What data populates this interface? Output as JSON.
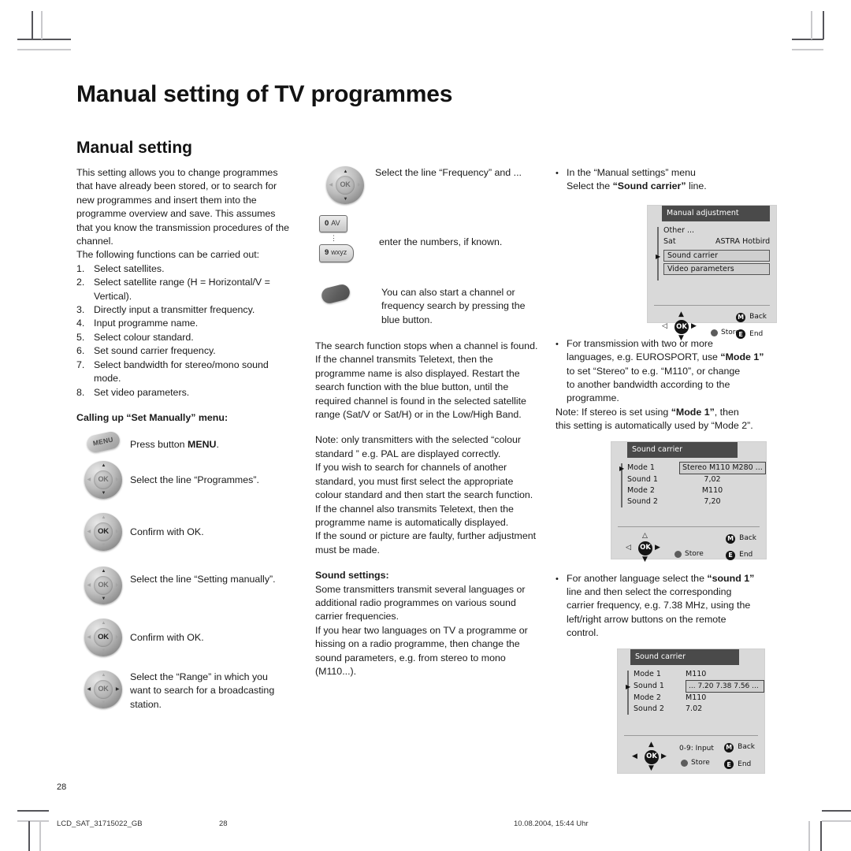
{
  "document": {
    "main_title": "Manual setting of TV programmes",
    "section_title": "Manual setting"
  },
  "left_column": {
    "intro": "This setting allows you to change programmes that have already been stored, or to search for new programmes and insert them into the programme overview and save. This assumes that you know the transmission procedures of the channel.",
    "functions_lead": "The following functions can be carried out:",
    "functions": [
      {
        "num": "1.",
        "text": "Select satellites."
      },
      {
        "num": "2.",
        "text": "Select satellite range (H = Horizontal/V = Vertical)."
      },
      {
        "num": "3.",
        "text": "Directly input a transmitter frequency."
      },
      {
        "num": "4.",
        "text": "Input programme name."
      },
      {
        "num": "5.",
        "text": "Select colour standard."
      },
      {
        "num": "6.",
        "text": "Set sound carrier frequency."
      },
      {
        "num": "7.",
        "text": "Select bandwidth for stereo/mono sound mode."
      },
      {
        "num": "8.",
        "text": "Set video parameters."
      }
    ],
    "calling_heading": "Calling up “Set Manually” menu:",
    "steps": [
      {
        "icon": "menu-key-icon",
        "key_label": "MENU",
        "text_before": "Press button ",
        "text_bold": "MENU",
        "text_after": "."
      },
      {
        "icon": "nav-pad-updown-icon",
        "ok_label": "OK",
        "text": "Select the line “Programmes”."
      },
      {
        "icon": "nav-pad-ok-icon",
        "ok_label": "OK",
        "text": "Confirm with OK."
      },
      {
        "icon": "nav-pad-updown-icon",
        "ok_label": "OK",
        "text": "Select the line “Setting manually”."
      },
      {
        "icon": "nav-pad-ok-icon",
        "ok_label": "OK",
        "text": "Confirm with OK."
      },
      {
        "icon": "nav-pad-leftright-icon",
        "ok_label": "OK",
        "text": "Select the “Range” in which you want to search for a broadcasting station."
      }
    ]
  },
  "middle_column": {
    "step_frequency": {
      "icon": "nav-pad-updown-icon",
      "ok_label": "OK",
      "text": "Select the line “Frequency” and ..."
    },
    "step_numbers": {
      "key_top_number": "0",
      "key_top_letters": "AV",
      "key_dots": "⋮",
      "key_bottom_number": "9",
      "key_bottom_letters": "wxyz",
      "text": "enter the numbers, if known."
    },
    "step_blue": {
      "icon": "blue-button-icon",
      "text": "You can also start a channel or frequency search by pressing the blue button."
    },
    "para_search": "The search function stops when a channel is found. If the channel transmits Teletext, then the programme name is also displayed. Restart the search function with the blue button, until the required channel is found in the selected satellite range (Sat/V or Sat/H) or in the Low/High Band.",
    "para_note": "Note: only transmitters with the selected “colour standard ” e.g. PAL are displayed correctly.",
    "para_standard": "If you wish to search for channels of another standard, you must first select the appropriate colour standard and then start the search function.",
    "para_teletext": "If the channel also transmits Teletext, then the programme name is automatically displayed.",
    "para_faulty": "If the sound or picture are faulty, further adjustment must be made.",
    "sound_heading": "Sound settings:",
    "para_sound1": "Some transmitters transmit several languages or additional radio programmes on various sound carrier frequencies.",
    "para_sound2": "If you hear two languages on TV a programme or hissing on a radio programme, then change the sound parameters, e.g. from stereo to mono (M110...)."
  },
  "right_column": {
    "bullet1": {
      "bullet": "•",
      "line1": "In the “Manual settings” menu",
      "line2_before": "Select the ",
      "line2_bold": "“Sound carrier”",
      "line2_after": " line."
    },
    "screen1": {
      "title": "Manual adjustment",
      "rows": [
        {
          "type": "plain",
          "label": "Other ..."
        },
        {
          "type": "kv",
          "label": "Sat",
          "value": "ASTRA  Hotbird"
        },
        {
          "type": "box",
          "label": "Sound carrier",
          "selected": true
        },
        {
          "type": "box",
          "label": "Video parameters",
          "selected": false
        }
      ],
      "footer": {
        "ok": "OK",
        "store": "Store",
        "back_badge": "M",
        "back": "Back",
        "end_badge": "E",
        "end": "End",
        "input_hint": ""
      }
    },
    "bullet2": {
      "bullet": "•",
      "line1": "For transmission with two or more",
      "line2_a": "languages, e.g. EUROSPORT, use ",
      "line2_bold": "“Mode 1”",
      "line3": "to set “Stereo” to e.g. “M110”, or change",
      "line4": "to another bandwidth according to the",
      "line5": "programme.",
      "note_a": "Note: If stereo is set using ",
      "note_bold": "“Mode 1”",
      "note_b": ", then",
      "note_c": "this setting is automatically used by “Mode 2”."
    },
    "screen2": {
      "title": "Sound carrier",
      "rows": [
        {
          "label": "Mode 1",
          "value": "Stereo M110 M280 ...",
          "boxed": true,
          "selected": true
        },
        {
          "label": "Sound 1",
          "value": "7,02",
          "boxed": false,
          "selected": false
        },
        {
          "label": "Mode 2",
          "value": "M110",
          "boxed": false,
          "selected": false
        },
        {
          "label": "Sound 2",
          "value": "7,20",
          "boxed": false,
          "selected": false
        }
      ],
      "footer": {
        "ok": "OK",
        "store": "Store",
        "back_badge": "M",
        "back": "Back",
        "end_badge": "E",
        "end": "End",
        "input_hint": ""
      }
    },
    "bullet3": {
      "bullet": "•",
      "line1_a": "For another language select the ",
      "line1_bold": "“sound 1”",
      "line2": "line and then select the corresponding",
      "line3": "carrier frequency, e.g. 7.38 MHz, using the",
      "line4": "left/right arrow buttons on the remote",
      "line5": "control."
    },
    "screen3": {
      "title": "Sound carrier",
      "rows": [
        {
          "label": "Mode 1",
          "value": "M110",
          "boxed": false,
          "selected": false
        },
        {
          "label": "Sound 1",
          "value": "...  7.20  7.38  7.56  ...",
          "boxed": true,
          "selected": true
        },
        {
          "label": "Mode 2",
          "value": "M110",
          "boxed": false,
          "selected": false
        },
        {
          "label": "Sound 2",
          "value": "7.02",
          "boxed": false,
          "selected": false
        }
      ],
      "footer": {
        "ok": "OK",
        "store": "Store",
        "back_badge": "M",
        "back": "Back",
        "end_badge": "E",
        "end": "End",
        "input_hint": "0-9: Input"
      }
    }
  },
  "footer": {
    "page_number": "28",
    "file_name": "LCD_SAT_31715022_GB",
    "footer_page": "28",
    "date": "10.08.2004, 15:44 Uhr"
  },
  "colors": {
    "text": "#1a1a1a",
    "screen_bg": "#d9d9d9",
    "screen_title_bg": "#4a4a4a",
    "key_dark": "#141414"
  }
}
